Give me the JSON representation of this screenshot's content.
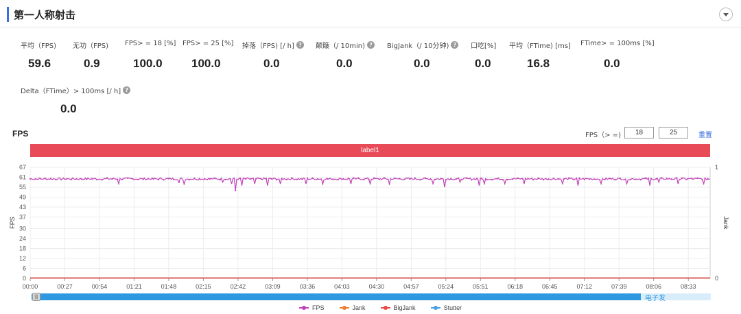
{
  "header": {
    "title": "第一人称射击"
  },
  "metrics": [
    {
      "label": "平均（FPS)",
      "value": "59.6",
      "help": false
    },
    {
      "label": "无功（FPS)",
      "value": "0.9",
      "help": false
    },
    {
      "label": "FPS> = 18 [%]",
      "value": "100.0",
      "help": false
    },
    {
      "label": "FPS> = 25 [%]",
      "value": "100.0",
      "help": false
    },
    {
      "label": "掉落（FPS) [/ h]",
      "value": "0.0",
      "help": true
    },
    {
      "label": "颠簸（/ 10min)",
      "value": "0.0",
      "help": true
    },
    {
      "label": "BigJank（/ 10分钟)",
      "value": "0.0",
      "help": true
    },
    {
      "label": "口吃[%]",
      "value": "0.0",
      "help": false
    },
    {
      "label": "平均（FTime) [ms]",
      "value": "16.8",
      "help": false
    },
    {
      "label": "FTime> = 100ms [%]",
      "value": "0.0",
      "help": false
    },
    {
      "label": "Delta（FTime）> 100ms [/ h]",
      "value": "0.0",
      "help": true
    }
  ],
  "fps_section": {
    "heading": "FPS",
    "threshold_label": "FPS（> =)",
    "threshold_1": "18",
    "threshold_2": "25",
    "reset_label": "重置",
    "label_bar": "label1"
  },
  "watermark": "电子发",
  "colors": {
    "accent": "#3b6fe0",
    "fps": "#c23fb8",
    "jank": "#f07e2c",
    "bigjank": "#e84a4a",
    "stutter": "#4a9ee8",
    "label_bar": "#e84a57",
    "scrollbar": "#2e98e0"
  },
  "chart_data": {
    "type": "line",
    "xlabel": "",
    "ylabel": "FPS",
    "y2label": "Jank",
    "ylim": [
      0,
      67
    ],
    "y2lim": [
      0,
      1
    ],
    "yticks": [
      0,
      6,
      12,
      18,
      24,
      30,
      37,
      43,
      49,
      55,
      61,
      67
    ],
    "y2ticks": [
      0,
      1
    ],
    "xticks": [
      "00:00",
      "00:27",
      "00:54",
      "01:21",
      "01:48",
      "02:15",
      "02:42",
      "03:09",
      "03:36",
      "04:03",
      "04:30",
      "04:57",
      "05:24",
      "05:51",
      "06:18",
      "06:45",
      "07:12",
      "07:39",
      "08:06",
      "08:33"
    ],
    "x_end": "08:50",
    "grid": true,
    "legend": "bottom",
    "series": [
      {
        "name": "FPS",
        "color": "#c23fb8",
        "baseline": 60,
        "dips": [
          [
            "01:09",
            57
          ],
          [
            "01:56",
            58
          ],
          [
            "02:00",
            57
          ],
          [
            "02:30",
            58
          ],
          [
            "02:37",
            57
          ],
          [
            "02:40",
            53
          ],
          [
            "02:45",
            56
          ],
          [
            "02:55",
            57
          ],
          [
            "03:05",
            56
          ],
          [
            "03:15",
            57
          ],
          [
            "03:35",
            57
          ],
          [
            "03:48",
            57
          ],
          [
            "04:10",
            57
          ],
          [
            "04:25",
            57
          ],
          [
            "04:40",
            57
          ],
          [
            "05:14",
            57
          ],
          [
            "05:23",
            55
          ],
          [
            "05:35",
            58
          ],
          [
            "05:50",
            56
          ],
          [
            "05:54",
            57
          ],
          [
            "06:10",
            57
          ],
          [
            "06:25",
            57
          ],
          [
            "06:55",
            57
          ],
          [
            "07:07",
            56
          ],
          [
            "07:25",
            57
          ],
          [
            "07:45",
            57
          ],
          [
            "08:03",
            56
          ],
          [
            "08:10",
            58
          ],
          [
            "08:25",
            57
          ],
          [
            "08:45",
            57
          ]
        ]
      },
      {
        "name": "Jank",
        "color": "#f07e2c",
        "values": [
          0
        ]
      },
      {
        "name": "BigJank",
        "color": "#e84a4a",
        "values": [
          0
        ]
      },
      {
        "name": "Stutter",
        "color": "#4a9ee8",
        "values": [
          0
        ]
      }
    ]
  }
}
